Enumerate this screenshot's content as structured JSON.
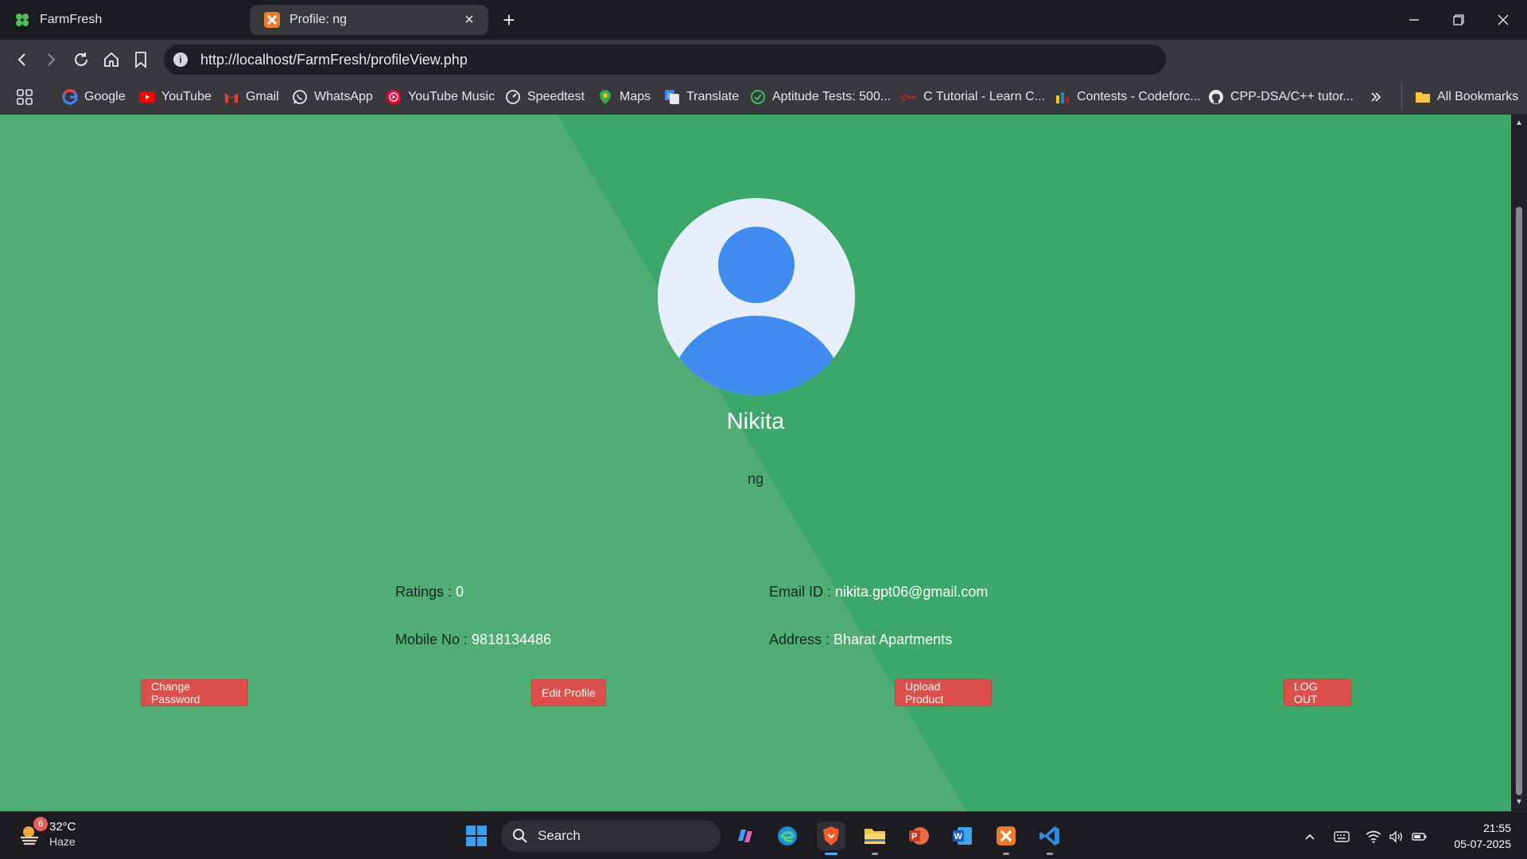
{
  "browser": {
    "tabs": [
      {
        "title": "FarmFresh",
        "icon": "clover-icon"
      },
      {
        "title": "Profile: ng",
        "icon": "xampp-icon"
      }
    ],
    "url": "http://localhost/FarmFresh/profileView.php",
    "bookmarks": [
      {
        "label": "Google",
        "icon": "google-icon"
      },
      {
        "label": "YouTube",
        "icon": "youtube-icon"
      },
      {
        "label": "Gmail",
        "icon": "gmail-icon"
      },
      {
        "label": "WhatsApp",
        "icon": "whatsapp-icon"
      },
      {
        "label": "YouTube Music",
        "icon": "youtube-music-icon"
      },
      {
        "label": "Speedtest",
        "icon": "speedtest-icon"
      },
      {
        "label": "Maps",
        "icon": "maps-icon"
      },
      {
        "label": "Translate",
        "icon": "translate-icon"
      },
      {
        "label": "Aptitude Tests: 500...",
        "icon": "check-circle-icon"
      },
      {
        "label": "C Tutorial - Learn C...",
        "icon": "cpp-icon"
      },
      {
        "label": "Contests - Codeforc...",
        "icon": "codeforces-icon"
      },
      {
        "label": "CPP-DSA/C++ tutor...",
        "icon": "github-icon"
      }
    ],
    "all_bookmarks": "All Bookmarks"
  },
  "profile": {
    "name": "Nikita",
    "username": "ng",
    "ratings_label": "Ratings : ",
    "ratings_value": "0",
    "email_label": "Email ID : ",
    "email_value": "nikita.gpt06@gmail.com",
    "mobile_label": "Mobile No : ",
    "mobile_value": "9818134486",
    "address_label": "Address : ",
    "address_value": "Bharat Apartments"
  },
  "actions": {
    "change_password": "Change Password",
    "edit_profile": "Edit Profile",
    "upload_product": "Upload Product",
    "logout": "LOG OUT"
  },
  "taskbar": {
    "weather_temp": "32°C",
    "weather_desc": "Haze",
    "weather_badge": "6",
    "search_label": "Search",
    "time": "21:55",
    "date": "05-07-2025"
  },
  "colors": {
    "page_bg": "#3ba86a",
    "page_bg_light": "#50ae75",
    "button": "#dc4f4a",
    "avatar_blue": "#3f8bf0"
  }
}
